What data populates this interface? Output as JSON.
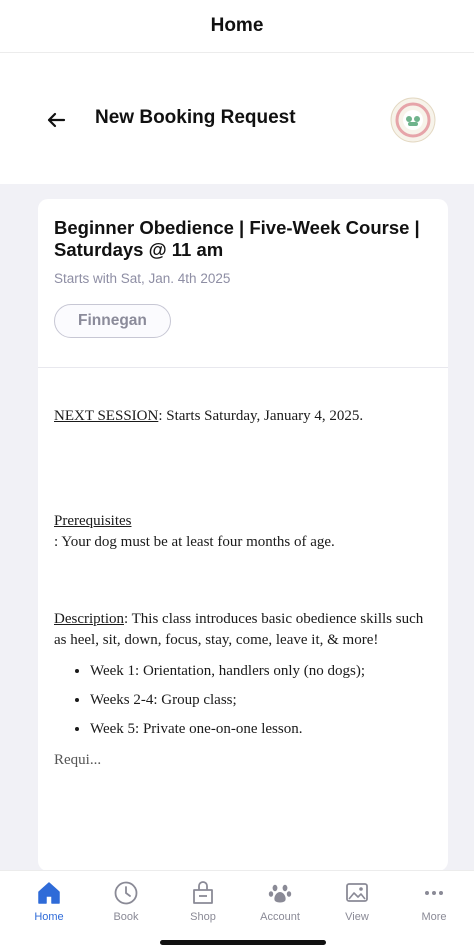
{
  "topbar": {
    "title": "Home"
  },
  "header": {
    "title": "New Booking Request",
    "logo_text": "Rush Hill Canine Center"
  },
  "course": {
    "title": "Beginner Obedience | Five-Week Course | Saturdays @ 11 am",
    "subtitle": "Starts with Sat, Jan. 4th 2025",
    "dog_chip": "Finnegan"
  },
  "description": {
    "next_label": "NEXT SESSION",
    "next_text": ": Starts Saturday, January 4, 2025.",
    "prereq_label": "Prerequisites",
    "prereq_text": ": Your dog must be at least four months of age.",
    "desc_label": "Description",
    "desc_text": ": This class introduces basic obedience skills such as heel, sit, down, focus, stay, come, leave it, & more!",
    "bullets": [
      "Week 1: Orientation, handlers only (no dogs);",
      "Weeks 2-4: Group class;",
      "Week 5: Private one-on-one lesson."
    ],
    "cutoff": "Requi..."
  },
  "tabs": [
    {
      "label": "Home",
      "icon": "home-icon",
      "active": true
    },
    {
      "label": "Book",
      "icon": "clock-icon",
      "active": false
    },
    {
      "label": "Shop",
      "icon": "shop-icon",
      "active": false
    },
    {
      "label": "Account",
      "icon": "paw-icon",
      "active": false
    },
    {
      "label": "View",
      "icon": "image-icon",
      "active": false
    },
    {
      "label": "More",
      "icon": "more-icon",
      "active": false
    }
  ],
  "colors": {
    "accent": "#2f6bd8",
    "muted": "#8e8ea4",
    "background": "#f1f1f6"
  }
}
